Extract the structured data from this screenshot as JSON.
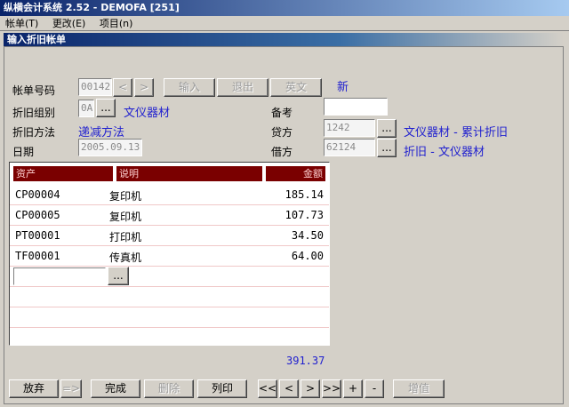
{
  "window": {
    "title": "纵横会计系统 2.52 - DEMOFA [251]"
  },
  "menu": {
    "items": [
      "帐单(T)",
      "更改(E)",
      "项目(n)"
    ]
  },
  "panel": {
    "title": "输入折旧帐单"
  },
  "form": {
    "voucher_label": "帐单号码",
    "voucher_value": "00142",
    "prev_label": "<",
    "next_label": ">",
    "input_label": "输入",
    "exit_label": "退出",
    "english_label": "英文",
    "status_text": "新",
    "group_label": "折旧组别",
    "group_code": "0A",
    "group_name": "文仪器材",
    "remark_label": "备考",
    "remark_value": "",
    "method_label": "折旧方法",
    "method_value": "递减方法",
    "credit_label": "贷方",
    "credit_code": "1242",
    "credit_name": "文仪器材 - 累计折旧",
    "date_label": "日期",
    "date_value": "2005.09.13",
    "debit_label": "借方",
    "debit_code": "62124",
    "debit_name": "折旧 - 文仪器材",
    "lookup_label": "..."
  },
  "grid": {
    "columns": [
      "资产",
      "说明",
      "金额"
    ],
    "rows": [
      {
        "asset": "CP00004",
        "desc": "复印机",
        "amount": "185.14"
      },
      {
        "asset": "CP00005",
        "desc": "复印机",
        "amount": "107.73"
      },
      {
        "asset": "PT00001",
        "desc": "打印机",
        "amount": "34.50"
      },
      {
        "asset": "TF00001",
        "desc": "传真机",
        "amount": "64.00"
      }
    ],
    "new_row_value": "",
    "total": "391.37"
  },
  "toolbar": {
    "discard": "放弃",
    "arrow": "=>",
    "done": "完成",
    "delete": "删除",
    "print": "列印",
    "first": "<<",
    "prev": "<",
    "next": ">",
    "last": ">>",
    "add": "+",
    "remove": "-",
    "add_value": "增值"
  }
}
